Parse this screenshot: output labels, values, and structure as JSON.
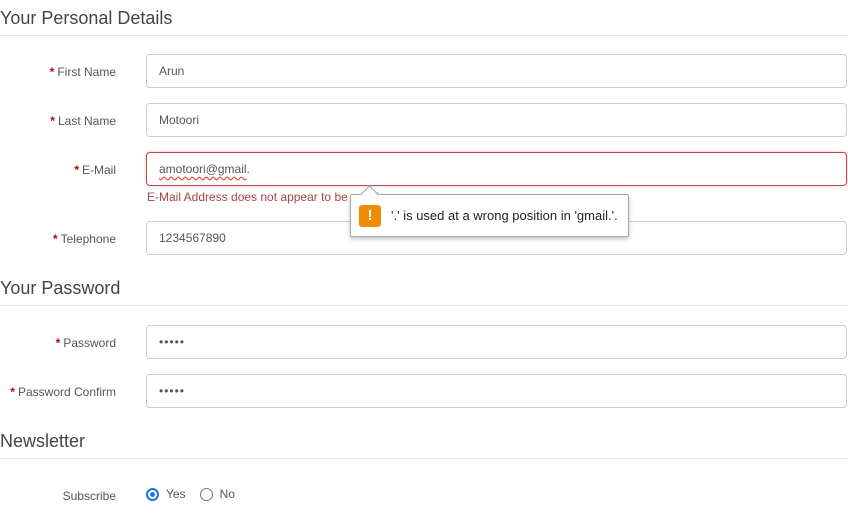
{
  "personal": {
    "heading": "Your Personal Details",
    "first_name": {
      "label": "First Name",
      "value": "Arun"
    },
    "last_name": {
      "label": "Last Name",
      "value": "Motoori"
    },
    "email": {
      "label": "E-Mail",
      "value": "amotoori@gmail.",
      "value_underlined": "amotoori@gmail",
      "value_trailing": ".",
      "error": "E-Mail Address does not appear to be valid!"
    },
    "telephone": {
      "label": "Telephone",
      "value": "1234567890"
    }
  },
  "tooltip": {
    "icon": "warning-icon",
    "icon_glyph": "!",
    "message": "'.' is used at a wrong position in 'gmail.'.",
    "icon_color": "#f08c00"
  },
  "password": {
    "heading": "Your Password",
    "password": {
      "label": "Password",
      "value": "•••••"
    },
    "confirm": {
      "label": "Password Confirm",
      "value": "•••••"
    }
  },
  "newsletter": {
    "heading": "Newsletter",
    "subscribe_label": "Subscribe",
    "options": [
      {
        "label": "Yes",
        "checked": true
      },
      {
        "label": "No",
        "checked": false
      }
    ]
  },
  "required_marker": "*",
  "colors": {
    "required": "#c00000",
    "error_text": "#a94442",
    "radio_accent": "#1a73e8"
  }
}
